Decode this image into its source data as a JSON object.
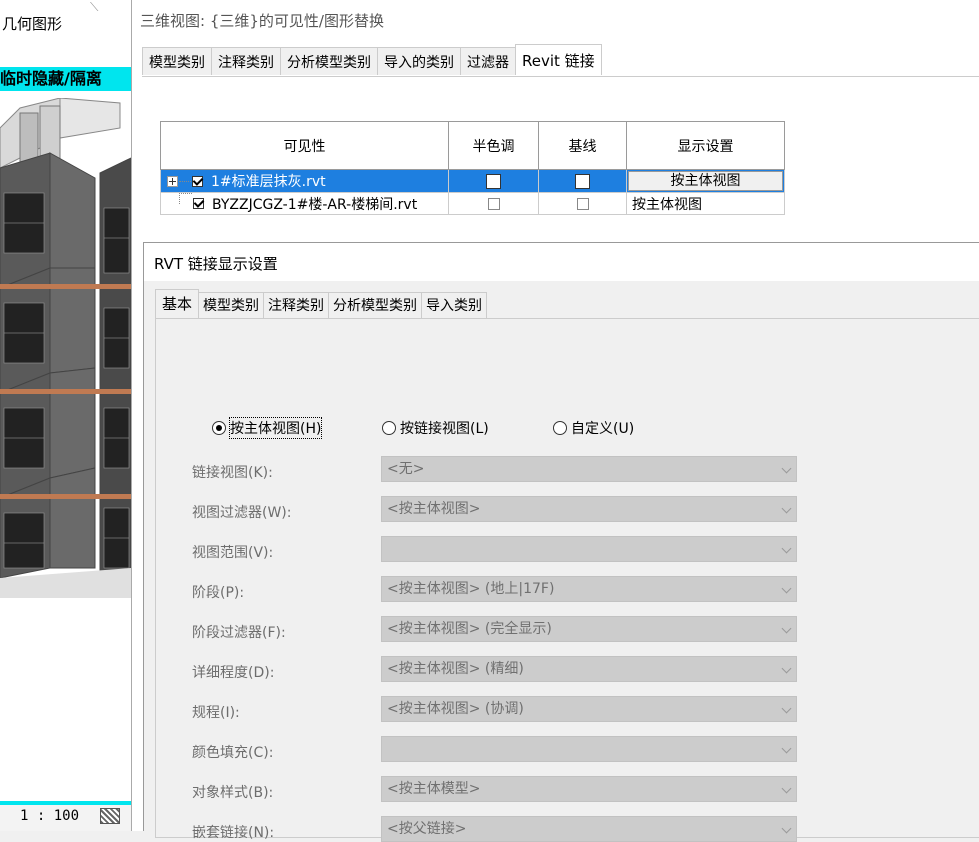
{
  "background_view": {
    "title": "几何图形",
    "banner": "临时隐藏/隔离",
    "scale": "1 : 100"
  },
  "vg_dialog": {
    "title": "三维视图: {三维}的可见性/图形替换",
    "tabs": [
      "模型类别",
      "注释类别",
      "分析模型类别",
      "导入的类别",
      "过滤器",
      "Revit 链接"
    ],
    "active_tab": "Revit 链接",
    "columns": {
      "visibility": "可见性",
      "halftone": "半色调",
      "underlay": "基线",
      "display_settings": "显示设置"
    },
    "rows": [
      {
        "name": "1#标准层抹灰.rvt",
        "visible": true,
        "halftone": false,
        "underlay": false,
        "display": "按主体视图",
        "selected": true
      },
      {
        "name": "BYZZJCGZ-1#楼-AR-楼梯间.rvt",
        "visible": true,
        "halftone": false,
        "underlay": false,
        "display": "按主体视图",
        "selected": false
      }
    ]
  },
  "rvt_dialog": {
    "title": "RVT 链接显示设置",
    "tabs": [
      "基本",
      "模型类别",
      "注释类别",
      "分析模型类别",
      "导入类别"
    ],
    "active_tab": "基本",
    "radios": [
      {
        "label": "按主体视图(H)",
        "selected": true
      },
      {
        "label": "按链接视图(L)",
        "selected": false
      },
      {
        "label": "自定义(U)",
        "selected": false
      }
    ],
    "fields": [
      {
        "label": "链接视图(K):",
        "value": "<无>"
      },
      {
        "label": "视图过滤器(W):",
        "value": "<按主体视图>"
      },
      {
        "label": "视图范围(V):",
        "value": ""
      },
      {
        "label": "阶段(P):",
        "value": "<按主体视图> (地上|17F)"
      },
      {
        "label": "阶段过滤器(F):",
        "value": "<按主体视图> (完全显示)"
      },
      {
        "label": "详细程度(D):",
        "value": "<按主体视图> (精细)"
      },
      {
        "label": "规程(I):",
        "value": "<按主体视图> (协调)"
      },
      {
        "label": "颜色填充(C):",
        "value": ""
      },
      {
        "label": "对象样式(B):",
        "value": "<按主体模型>"
      },
      {
        "label": "嵌套链接(N):",
        "value": "<按父链接>"
      }
    ]
  }
}
